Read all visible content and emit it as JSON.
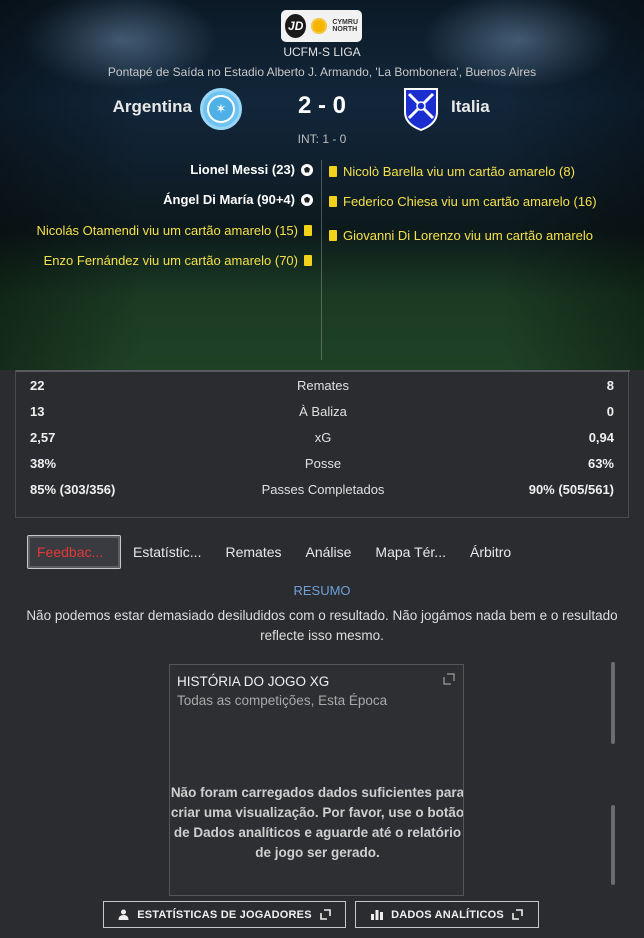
{
  "header": {
    "logo": {
      "jd": "JD",
      "text_line1": "CYMRU",
      "text_line2": "NORTH"
    },
    "league": "UCFM-S LIGA",
    "venue": "Pontapé de Saída no Estadio Alberto J. Armando, 'La Bombonera', Buenos Aires"
  },
  "match": {
    "home_team": "Argentina",
    "away_team": "Italia",
    "score": "2 - 0",
    "halftime": "INT: 1 - 0"
  },
  "events": {
    "home": [
      {
        "type": "goal",
        "text": "Lionel Messi (23)"
      },
      {
        "type": "goal",
        "text": "Ángel Di María (90+4)"
      },
      {
        "type": "yellow",
        "text": "Nicolás Otamendi viu um cartão amarelo (15)"
      },
      {
        "type": "yellow",
        "text": "Enzo Fernández viu um cartão amarelo (70)"
      }
    ],
    "away": [
      {
        "type": "yellow",
        "text": "Nicolò Barella viu um cartão amarelo (8)"
      },
      {
        "type": "yellow",
        "text": "Federico Chiesa viu um cartão amarelo (16)"
      },
      {
        "type": "yellow",
        "text": "Giovanni Di Lorenzo viu um cartão amarelo"
      }
    ]
  },
  "stats": [
    {
      "label": "Remates",
      "home": "22",
      "away": "8"
    },
    {
      "label": "À Baliza",
      "home": "13",
      "away": "0"
    },
    {
      "label": "xG",
      "home": "2,57",
      "away": "0,94"
    },
    {
      "label": "Posse",
      "home": "38%",
      "away": "63%"
    },
    {
      "label": "Passes Completados",
      "home": "85% (303/356)",
      "away": "90% (505/561)"
    }
  ],
  "tabs": [
    "Feedbac...",
    "Estatístic...",
    "Remates",
    "Análise",
    "Mapa Tér...",
    "Árbitro"
  ],
  "resumo": {
    "title": "RESUMO",
    "text": "Não podemos estar demasiado desiludidos com o resultado. Não jogámos nada bem e o resultado reflecte isso mesmo."
  },
  "xg_panel": {
    "title": "HISTÓRIA DO JOGO XG",
    "subtitle": "Todas as competições, Esta Época",
    "message": "Não foram carregados dados suficientes para criar uma visualização. Por favor, use o botão de Dados analíticos e aguarde até o relatório de jogo ser gerado."
  },
  "footer": {
    "player_stats": "ESTATÍSTICAS DE JOGADORES",
    "analytics": "DADOS ANALÍTICOS"
  },
  "colors": {
    "yellow_card": "#f2d21b",
    "active_tab_text": "#e13a3a",
    "resumo_title": "#6fa0d8",
    "argentina_crest": "#6ec3f0",
    "italia_crest": "#1b2fd0"
  }
}
